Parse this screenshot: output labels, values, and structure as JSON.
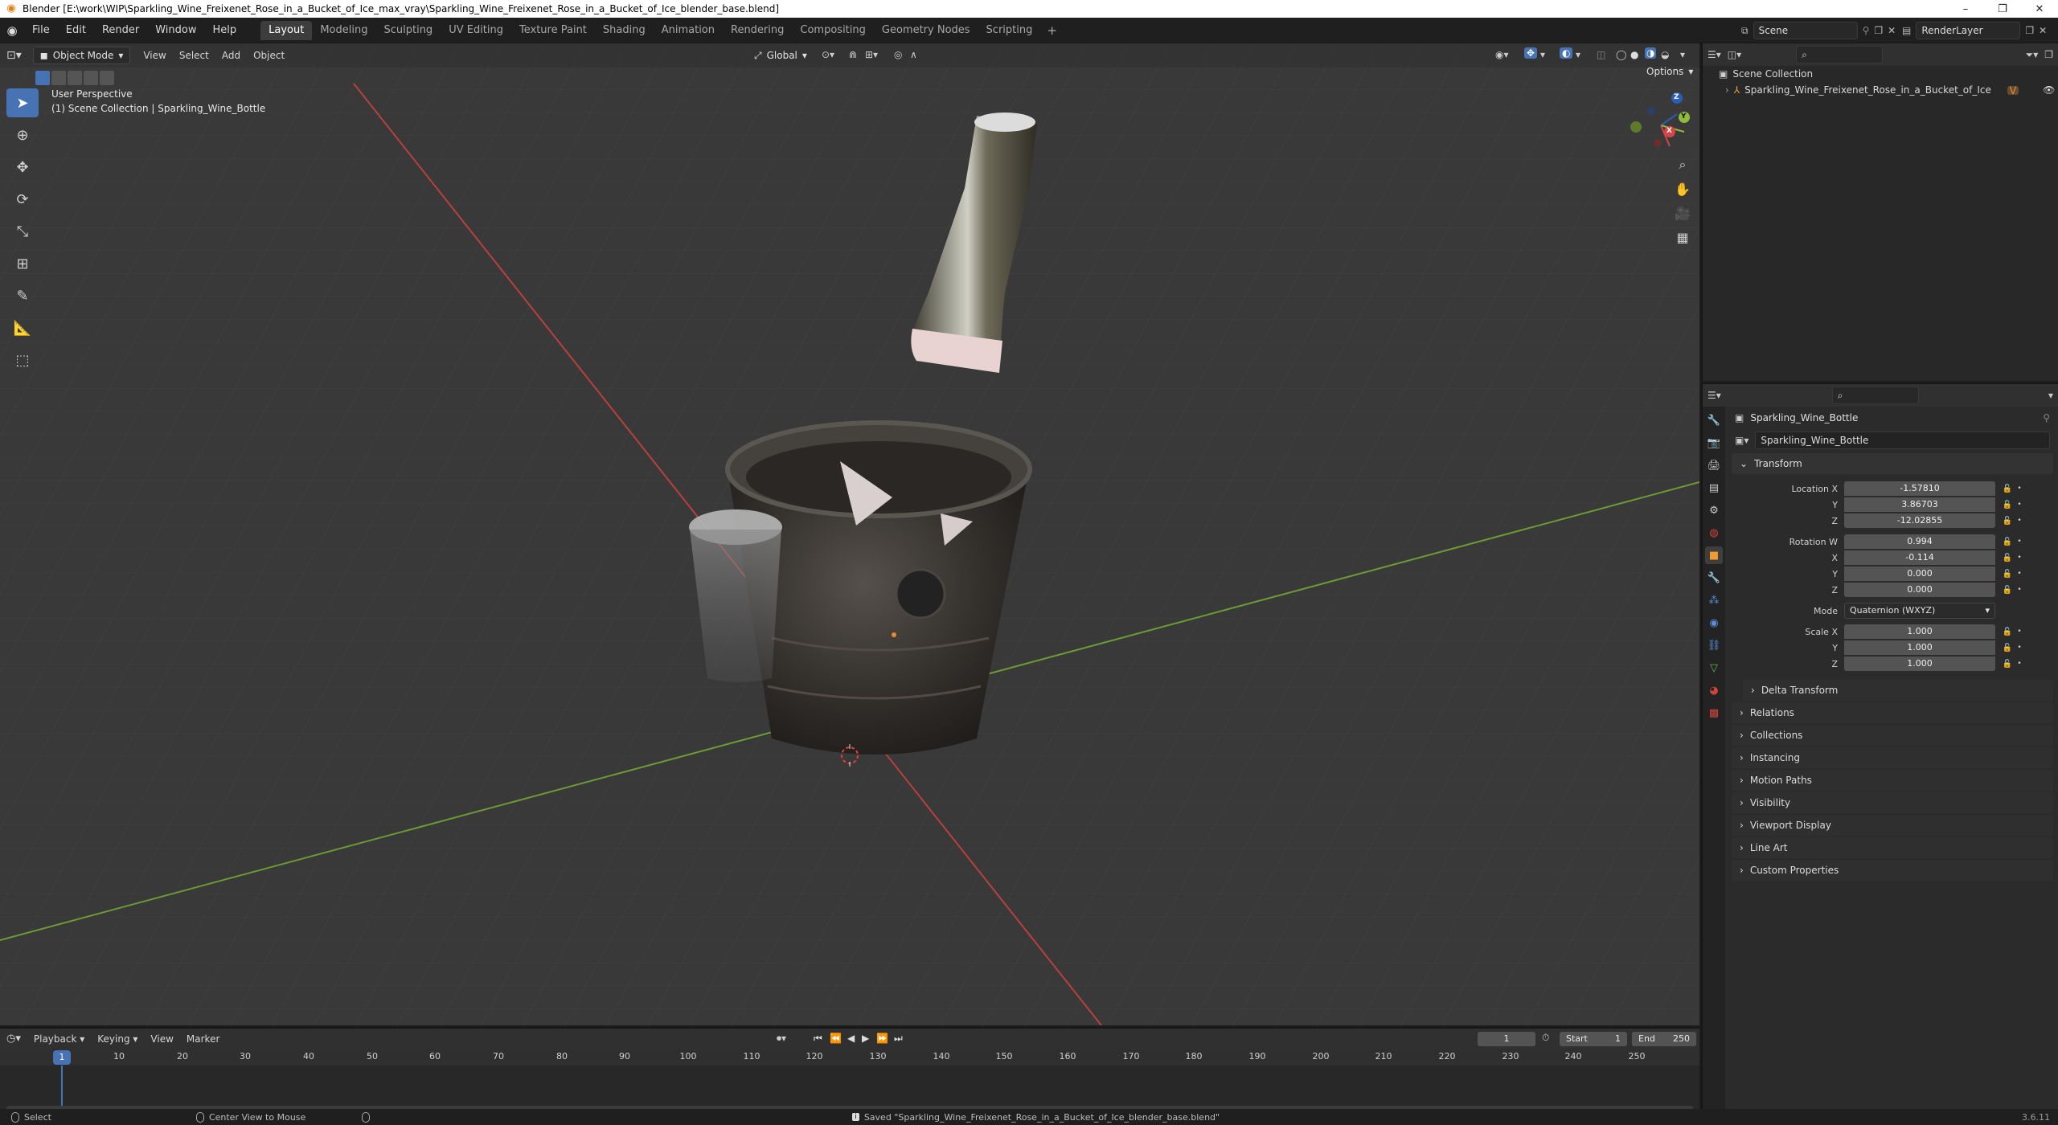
{
  "window": {
    "title": "Blender [E:\\work\\WIP\\Sparkling_Wine_Freixenet_Rose_in_a_Bucket_of_Ice_max_vray\\Sparkling_Wine_Freixenet_Rose_in_a_Bucket_of_Ice_blender_base.blend]",
    "minimize": "–",
    "restore": "❐",
    "close": "✕"
  },
  "menu": {
    "file": "File",
    "edit": "Edit",
    "render": "Render",
    "window": "Window",
    "help": "Help"
  },
  "workspaces": [
    "Layout",
    "Modeling",
    "Sculpting",
    "UV Editing",
    "Texture Paint",
    "Shading",
    "Animation",
    "Rendering",
    "Compositing",
    "Geometry Nodes",
    "Scripting"
  ],
  "workspace_add": "+",
  "scene": {
    "name": "Scene",
    "render_layer": "RenderLayer"
  },
  "viewport": {
    "mode": "Object Mode",
    "view": "View",
    "select": "Select",
    "add": "Add",
    "object": "Object",
    "orientation": "Global",
    "options": "Options",
    "perspective": "User Perspective",
    "collection_info": "(1) Scene Collection | Sparkling_Wine_Bottle",
    "gizmo": {
      "x": "X",
      "y": "Y",
      "z": "Z"
    }
  },
  "outliner": {
    "scene_collection": "Scene Collection",
    "object": "Sparkling_Wine_Freixenet_Rose_in_a_Bucket_of_Ice"
  },
  "properties": {
    "object_name": "Sparkling_Wine_Bottle",
    "data_name": "Sparkling_Wine_Bottle",
    "transform": {
      "title": "Transform",
      "location_label": "Location X",
      "location": [
        "-1.57810",
        "3.86703",
        "-12.02855"
      ],
      "rotation_label": "Rotation W",
      "rotation": [
        "0.994",
        "-0.114",
        "0.000",
        "0.000"
      ],
      "mode_label": "Mode",
      "mode_value": "Quaternion (WXYZ)",
      "scale_label": "Scale X",
      "scale": [
        "1.000",
        "1.000",
        "1.000"
      ],
      "y": "Y",
      "z": "Z",
      "x": "X"
    },
    "delta_transform": "Delta Transform",
    "panels": [
      "Relations",
      "Collections",
      "Instancing",
      "Motion Paths",
      "Visibility",
      "Viewport Display",
      "Line Art",
      "Custom Properties"
    ]
  },
  "timeline": {
    "playback": "Playback",
    "keying": "Keying",
    "view": "View",
    "marker": "Marker",
    "current_frame": "1",
    "start_label": "Start",
    "start": "1",
    "end_label": "End",
    "end": "250",
    "ticks": [
      "10",
      "20",
      "30",
      "40",
      "50",
      "60",
      "70",
      "80",
      "90",
      "100",
      "110",
      "120",
      "130",
      "140",
      "150",
      "160",
      "170",
      "180",
      "190",
      "200",
      "210",
      "220",
      "230",
      "240",
      "250"
    ],
    "playhead": "1"
  },
  "status": {
    "select": "Select",
    "center_view": "Center View to Mouse",
    "message": "Saved \"Sparkling_Wine_Freixenet_Rose_in_a_Bucket_of_Ice_blender_base.blend\"",
    "version": "3.6.11"
  },
  "colors": {
    "accent": "#4772b3",
    "x_axis": "#d4484a",
    "y_axis": "#7ab03a",
    "viewport_bg": "#393939"
  }
}
